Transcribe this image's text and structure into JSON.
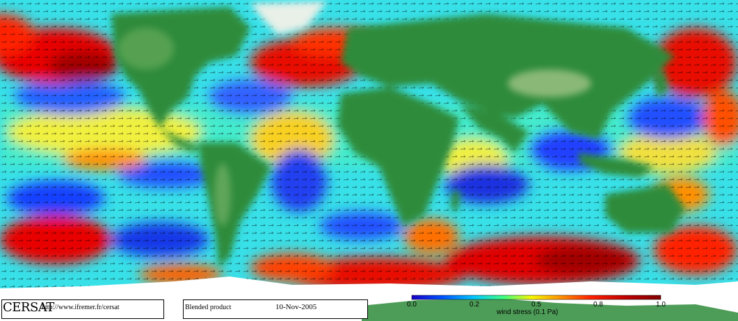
{
  "header": {
    "brand": "CERSAT",
    "url": "http://www.ifremer.fr/cersat",
    "product": "Blended product",
    "date": "10-Nov-2005"
  },
  "colorbar": {
    "title": "wind stress (0.1 Pa)",
    "ticks": [
      "0.0",
      "0.2",
      "0.5",
      "0.8",
      "1.0"
    ],
    "tick_values": [
      0.0,
      0.2,
      0.5,
      0.8,
      1.0
    ],
    "range": [
      0.0,
      1.0
    ],
    "colors": [
      "#1a00c8",
      "#0050ff",
      "#00c8ff",
      "#40ff80",
      "#f8f800",
      "#ff9000",
      "#ff2000",
      "#c00000",
      "#800000"
    ]
  },
  "map": {
    "projection": "equirectangular",
    "land_color": "#2e8b3a",
    "ice_color": "#ffffff",
    "vector_color": "#000000"
  }
}
